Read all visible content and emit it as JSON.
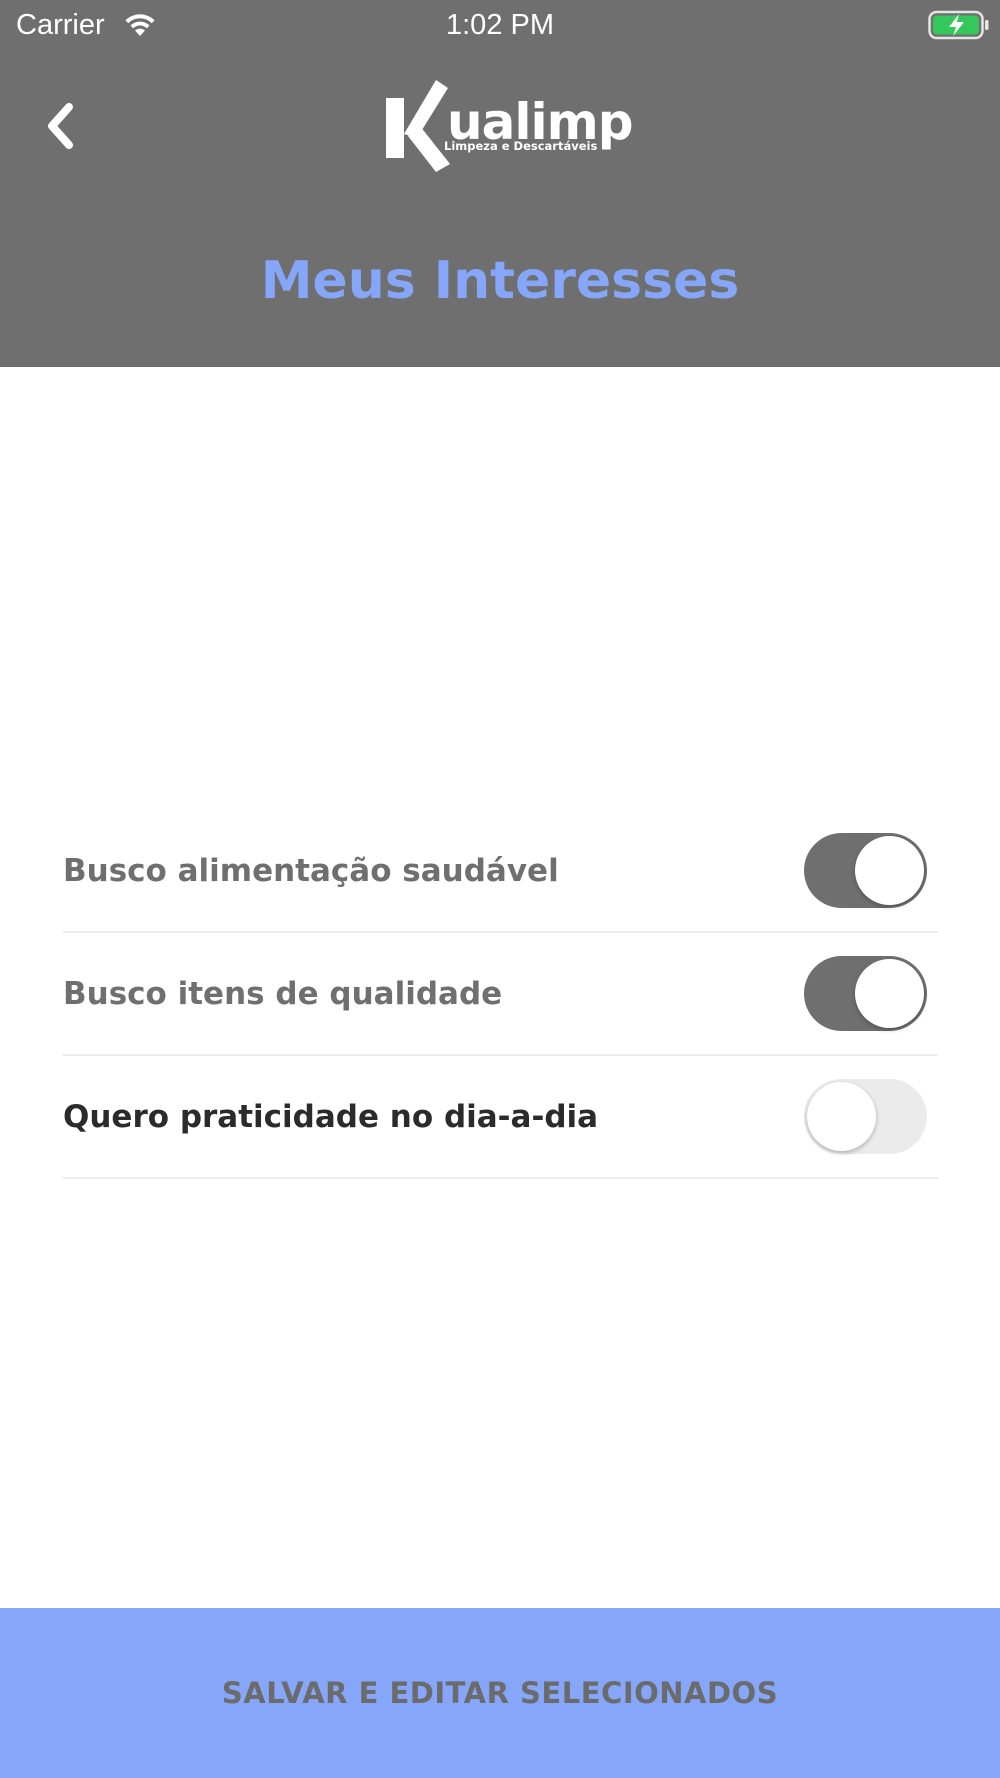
{
  "status_bar": {
    "carrier": "Carrier",
    "time": "1:02 PM",
    "battery_icon": "battery-charging-icon",
    "wifi_icon": "wifi-icon"
  },
  "header": {
    "back_icon": "chevron-left-icon",
    "logo": {
      "wordmark": "ualimp",
      "initial": "K",
      "tagline": "Limpeza e Descartáveis"
    },
    "title": "Meus Interesses"
  },
  "interests": [
    {
      "label": "Busco alimentação saudável",
      "enabled": true
    },
    {
      "label": "Busco itens de qualidade",
      "enabled": true
    },
    {
      "label": "Quero praticidade no dia-a-dia",
      "enabled": false
    }
  ],
  "footer": {
    "save_label": "SALVAR E EDITAR SELECIONADOS"
  },
  "colors": {
    "header_bg": "#6f6f6f",
    "accent": "#86a6fa",
    "toggle_on": "#6f6f6f",
    "toggle_off": "#ebebeb"
  }
}
